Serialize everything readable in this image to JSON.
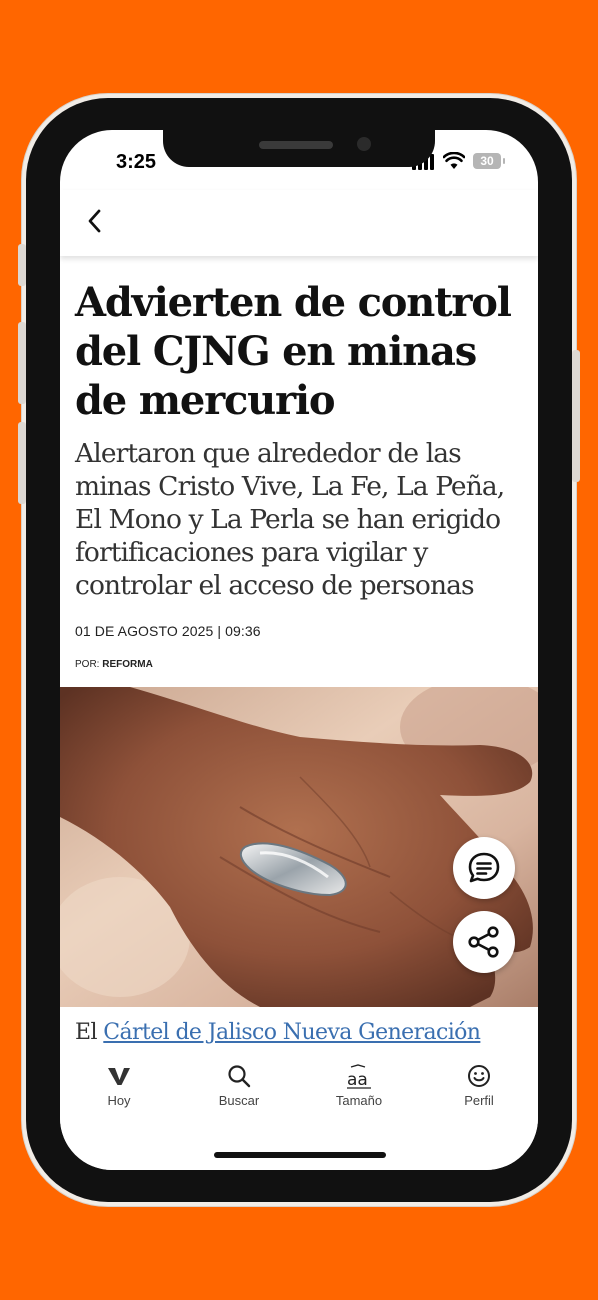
{
  "status_bar": {
    "time": "3:25",
    "battery": "30"
  },
  "nav": {
    "back_icon": "chevron-left-icon"
  },
  "article": {
    "headline": "Advierten de control del CJNG en minas de mercurio",
    "subheadline": "Alertaron que alrededor de las minas Cristo Vive, La Fe, La Peña, El Mono y La Perla se han erigido fortificaciones para vigilar y controlar el acceso de personas",
    "date": "01 DE AGOSTO 2025 | 09:36",
    "byline_prefix": "POR:",
    "byline_author": "REFORMA",
    "body_lead": "El ",
    "body_link": "Cártel de Jalisco Nueva Generación"
  },
  "floating_actions": [
    {
      "name": "comments",
      "icon": "comment-icon"
    },
    {
      "name": "share",
      "icon": "share-icon"
    }
  ],
  "tabbar": {
    "items": [
      {
        "label": "Hoy",
        "icon": "v-logo-icon"
      },
      {
        "label": "Buscar",
        "icon": "search-icon"
      },
      {
        "label": "Tamaño",
        "icon": "text-size-icon"
      },
      {
        "label": "Perfil",
        "icon": "smiley-icon"
      }
    ]
  },
  "colors": {
    "background": "#FF6600",
    "link": "#3a6fb0",
    "text": "#111111"
  }
}
